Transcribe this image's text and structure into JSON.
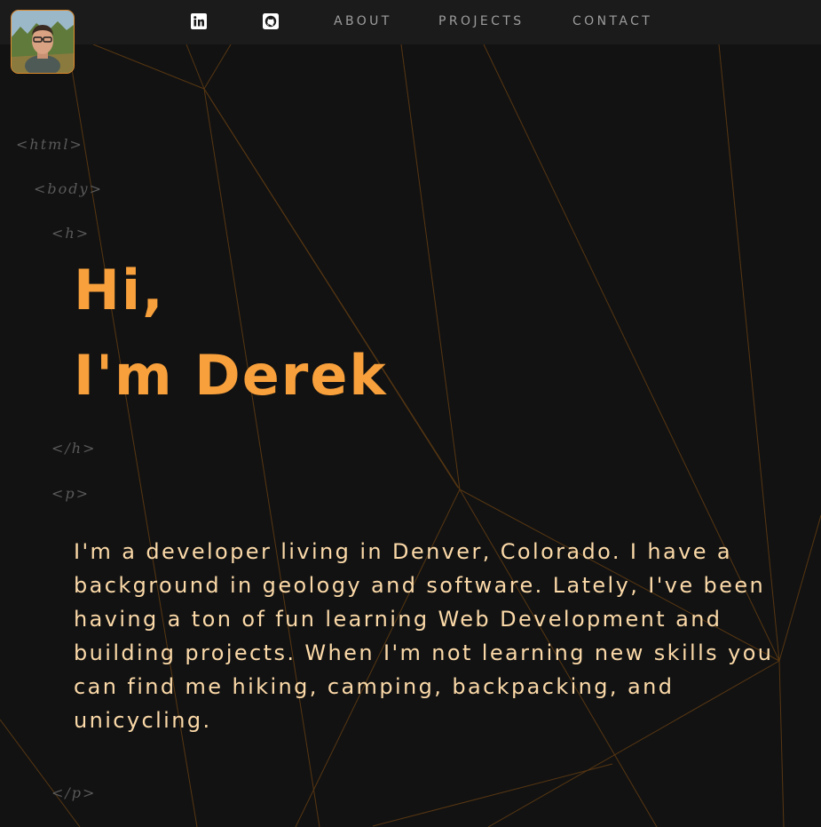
{
  "nav": {
    "avatar_alt": "Derek profile photo",
    "icons": [
      {
        "name": "linkedin-icon",
        "label": "LinkedIn"
      },
      {
        "name": "github-icon",
        "label": "GitHub"
      }
    ],
    "links": [
      "ABOUT",
      "PROJECTS",
      "CONTACT"
    ]
  },
  "code_tags": {
    "html_open": "<html>",
    "body_open": "<body>",
    "h_open": "<h>",
    "h_close": "</h>",
    "p_open": "<p>",
    "p_close": "</p>"
  },
  "hero": {
    "line1": "Hi,",
    "line2": "I'm Derek"
  },
  "bio": {
    "text": "I'm a developer living in Denver, Colorado. I have a background in geology and software. Lately, I've been having a ton of fun learning Web Development and building projects. When I'm not learning new skills you can find me hiking, camping, backpacking, and unicycling."
  },
  "colors": {
    "background": "#121212",
    "navbar": "#1b1b1b",
    "accent": "#f8a03c",
    "bio_text": "#fbd9a8",
    "tag_text": "#5a5a5a",
    "nav_text": "#9d9d9d",
    "line_stroke": "#7a4a14"
  }
}
